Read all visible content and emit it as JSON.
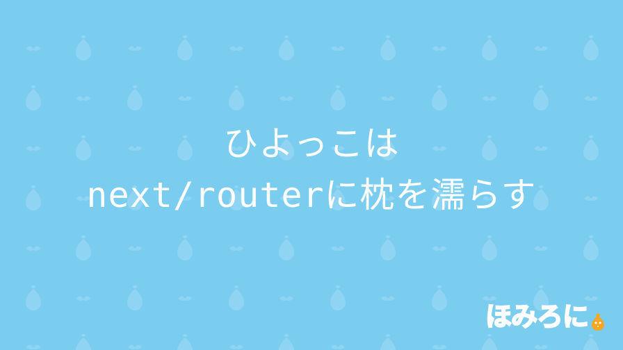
{
  "title": {
    "line1": "ひよっこは",
    "line2": "next/routerに枕を濡らす"
  },
  "logo": {
    "text": "ほみろに"
  },
  "colors": {
    "background": "#7bcdf0",
    "pattern": "#8fd5f3",
    "text": "#ffffff",
    "chick": "#f5a623"
  }
}
